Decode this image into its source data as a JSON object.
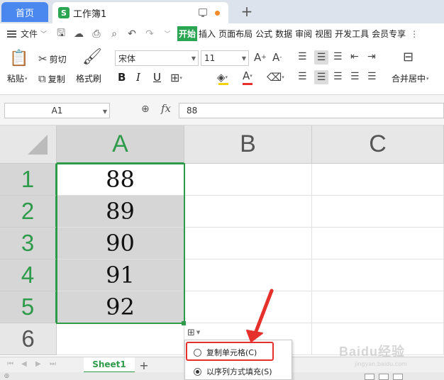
{
  "titlebar": {
    "home_tab": "首页",
    "doc_logo": "S",
    "doc_title": "工作簿1",
    "new_tab": "+"
  },
  "menubar": {
    "file": "文件",
    "tabs": [
      "开始",
      "插入",
      "页面布局",
      "公式",
      "数据",
      "审阅",
      "视图",
      "开发工具",
      "会员专享"
    ],
    "active_tab": "开始"
  },
  "ribbon": {
    "paste": "粘贴",
    "cut": "剪切",
    "copy": "复制",
    "format_painter": "格式刷",
    "font_name": "宋体",
    "font_size": "11",
    "merge_center": "合并居中"
  },
  "formula": {
    "name_box": "A1",
    "fx_label": "fx",
    "value": "88"
  },
  "grid": {
    "columns": [
      "A",
      "B",
      "C"
    ],
    "active_column": "A",
    "rows": [
      "1",
      "2",
      "3",
      "4",
      "5",
      "6"
    ],
    "values": [
      "88",
      "89",
      "90",
      "91",
      "92"
    ]
  },
  "autofill_menu": {
    "items": [
      "复制单元格(C)",
      "以序列方式填充(S)"
    ],
    "selected_index": 1,
    "highlight_index": 0
  },
  "sheets": {
    "tabs": [
      "Sheet1"
    ],
    "add": "+"
  },
  "colors": {
    "accent_green": "#2e9b4a",
    "home_tab_blue": "#4a87ef",
    "highlight_red": "#e5302b"
  },
  "watermark": {
    "text": "Baidu经验",
    "sub": "jingyan.baidu.com"
  }
}
